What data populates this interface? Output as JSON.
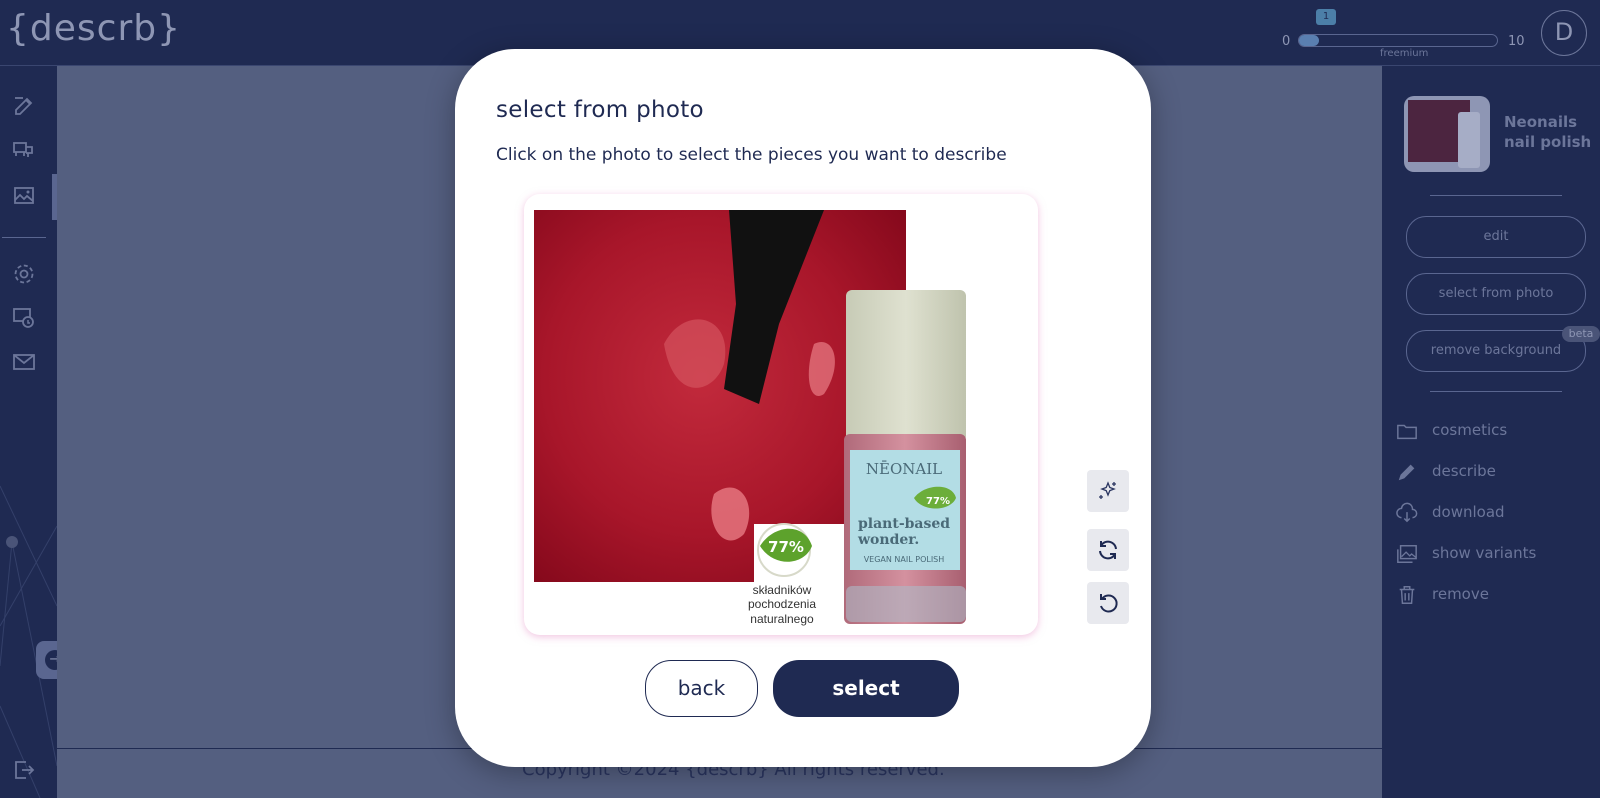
{
  "header": {
    "logo": "{descrb}",
    "credits": {
      "min": "0",
      "max": "10",
      "used": "1",
      "used_fraction": 0.1,
      "plan": "freemium"
    },
    "avatar_initial": "D"
  },
  "left_sidebar": {
    "icons": [
      "edit-icon",
      "product-icon",
      "image-icon",
      "settings-icon",
      "billing-icon",
      "mail-icon",
      "logout-icon"
    ],
    "expand_icon": "→"
  },
  "right_panel": {
    "product_name": "Neonails nail polish",
    "buttons": {
      "edit": "edit",
      "select_from_photo": "select from photo",
      "remove_background": "remove background",
      "beta": "beta"
    },
    "menu": [
      {
        "icon": "folder-icon",
        "label": "cosmetics"
      },
      {
        "icon": "pencil-icon",
        "label": "describe"
      },
      {
        "icon": "download-icon",
        "label": "download"
      },
      {
        "icon": "images-icon",
        "label": "show variants"
      },
      {
        "icon": "trash-icon",
        "label": "remove"
      }
    ]
  },
  "modal": {
    "title": "select from photo",
    "subtitle": "Click on the photo to select the pieces you want to describe",
    "photo": {
      "badge": "77%",
      "bottle_brand": "NĒONAIL",
      "bottle_badge": "77%",
      "bottle_line1": "plant-based",
      "bottle_line2": "wonder.",
      "bottle_line3": "VEGAN NAIL POLISH",
      "caption": [
        "składników",
        "pochodzenia",
        "naturalnego"
      ]
    },
    "tools": [
      "magic-select-icon",
      "refresh-icon",
      "undo-icon"
    ],
    "back_label": "back",
    "select_label": "select"
  },
  "footer": {
    "text": "Copyright ©2024 {descrb} All rights reserved."
  }
}
